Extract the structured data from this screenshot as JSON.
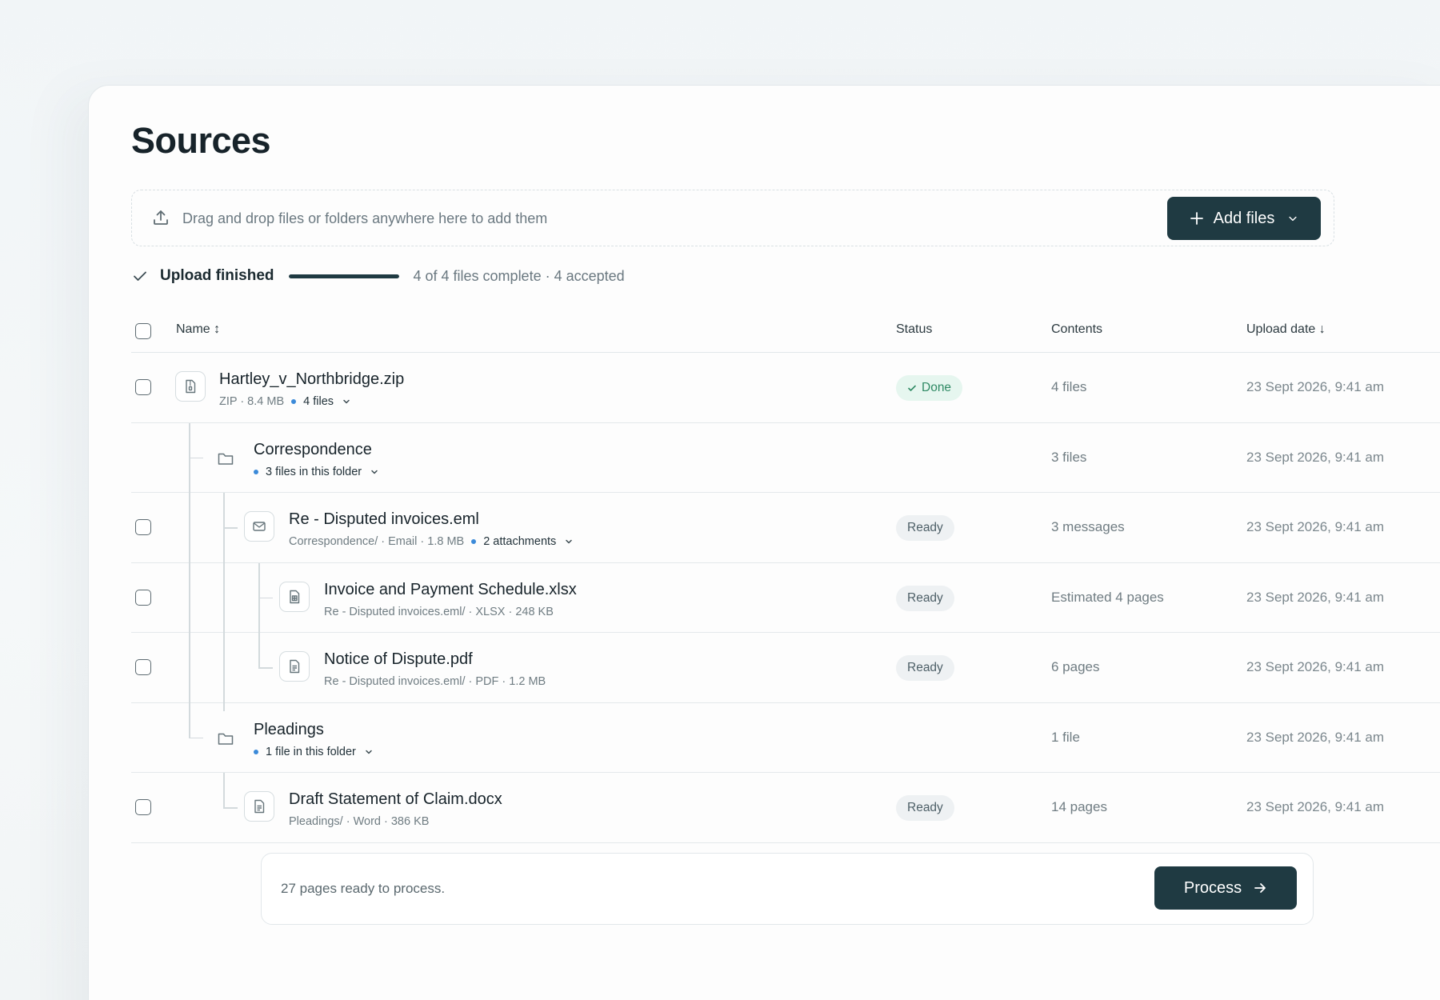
{
  "page_title": "Sources",
  "dropzone": {
    "hint": "Drag and drop files or folders anywhere here to add them",
    "add_button_label": "Add files"
  },
  "upload_status": {
    "label": "Upload finished",
    "progress": 1.0,
    "summary": "4 of 4 files complete · 4 accepted"
  },
  "table": {
    "columns": {
      "name": "Name ↕",
      "status": "Status",
      "contents": "Contents",
      "upload_date": "Upload date ↓"
    },
    "rows": [
      {
        "name": "Hartley_v_Northbridge.zip",
        "meta_prefix": "ZIP · 8.4 MB",
        "meta_accent": "4 files",
        "status": "Done",
        "contents": "4 files",
        "date": "23 Sept 2026, 9:41 am"
      },
      {
        "name": "Correspondence",
        "meta_accent": "3 files in this folder",
        "contents": "3 files",
        "date": "23 Sept 2026, 9:41 am"
      },
      {
        "name": "Re - Disputed invoices.eml",
        "meta_prefix": "Correspondence/ · Email · 1.8 MB",
        "meta_accent": "2 attachments",
        "status": "Ready",
        "contents": "3 messages",
        "date": "23 Sept 2026, 9:41 am"
      },
      {
        "name": "Invoice and Payment Schedule.xlsx",
        "meta_prefix": "Re - Disputed invoices.eml/ · XLSX · 248 KB",
        "status": "Ready",
        "contents": "Estimated 4 pages",
        "date": "23 Sept 2026, 9:41 am"
      },
      {
        "name": "Notice of Dispute.pdf",
        "meta_prefix": "Re - Disputed invoices.eml/ · PDF · 1.2 MB",
        "status": "Ready",
        "contents": "6 pages",
        "date": "23 Sept 2026, 9:41 am"
      },
      {
        "name": "Pleadings",
        "meta_accent": "1 file in this folder",
        "contents": "1 file",
        "date": "23 Sept 2026, 9:41 am"
      },
      {
        "name": "Draft Statement of Claim.docx",
        "meta_prefix": "Pleadings/ · Word · 386 KB",
        "status": "Ready",
        "contents": "14 pages",
        "date": "23 Sept 2026, 9:41 am"
      }
    ]
  },
  "footer": {
    "text": "27 pages ready to process.",
    "process_button_label": "Process"
  },
  "colors": {
    "primary_button": "#1f3a42",
    "accent_dot": "#3b8ad9",
    "done_badge_text": "#2f8a64",
    "done_badge_bg": "#e6f6ef"
  }
}
